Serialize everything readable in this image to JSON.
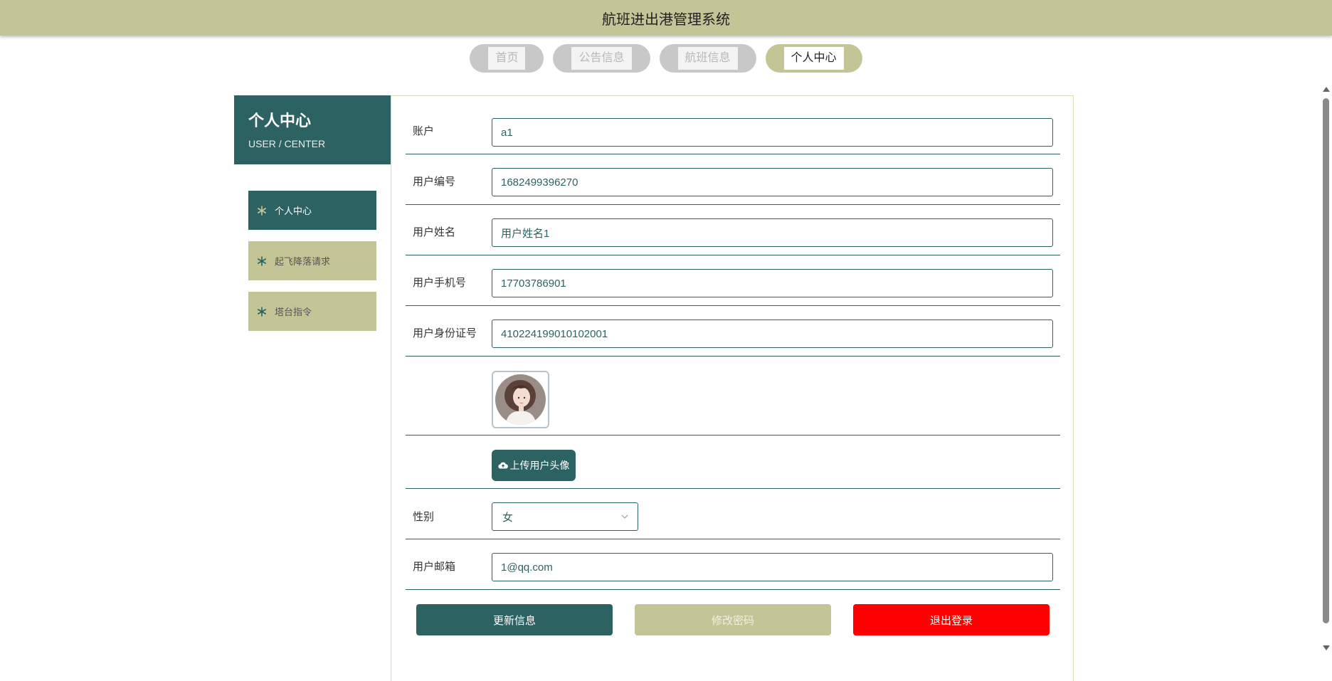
{
  "header": {
    "title": "航班进出港管理系统"
  },
  "nav": {
    "tabs": [
      {
        "label": "首页"
      },
      {
        "label": "公告信息"
      },
      {
        "label": "航班信息"
      },
      {
        "label": "个人中心"
      }
    ],
    "active": "个人中心"
  },
  "sidebar": {
    "title": "个人中心",
    "subtitle": "USER / CENTER",
    "items": [
      {
        "label": "个人中心",
        "icon": "snowflake-icon"
      },
      {
        "label": "起飞降落请求",
        "icon": "snowflake-icon"
      },
      {
        "label": "塔台指令",
        "icon": "snowflake-icon"
      }
    ]
  },
  "form": {
    "account": {
      "label": "账户",
      "value": "a1"
    },
    "user_no": {
      "label": "用户编号",
      "value": "1682499396270"
    },
    "user_name": {
      "label": "用户姓名",
      "value": "用户姓名1"
    },
    "phone": {
      "label": "用户手机号",
      "value": "17703786901"
    },
    "id_card": {
      "label": "用户身份证号",
      "value": "410224199010102001"
    },
    "upload_button": "上传用户头像",
    "gender": {
      "label": "性别",
      "value": "女"
    },
    "email": {
      "label": "用户邮箱",
      "value": "1@qq.com"
    }
  },
  "actions": {
    "update": "更新信息",
    "change_password": "修改密码",
    "logout": "退出登录"
  },
  "colors": {
    "olive": "#c4c596",
    "teal": "#2d6262",
    "red": "#ff0000"
  }
}
